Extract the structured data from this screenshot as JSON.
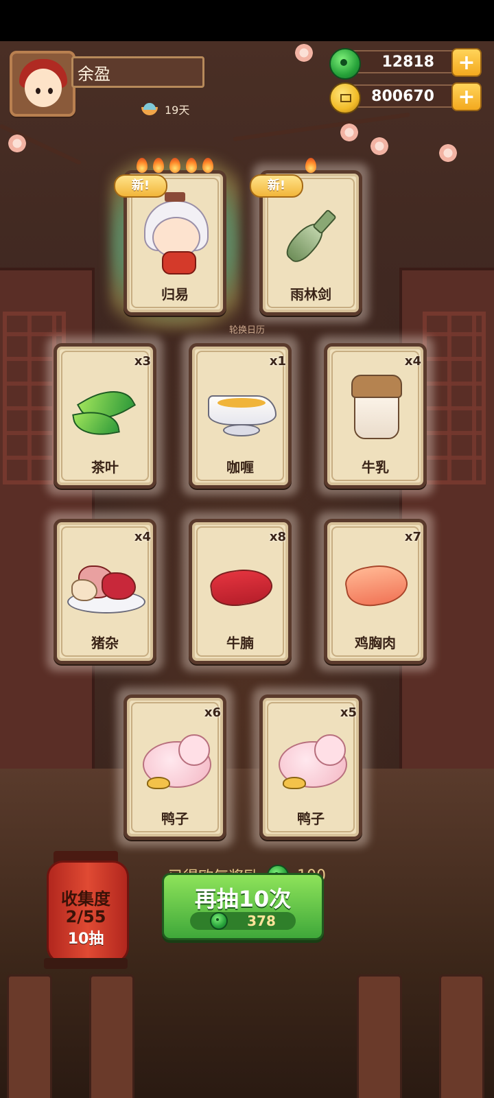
{
  "player": {
    "name": "余盈",
    "days": "19天"
  },
  "currencies": {
    "jade": "12818",
    "coins": "800670",
    "plus_label": "+"
  },
  "background_text": {
    "calendar": "轮换日历"
  },
  "new_label": "新!",
  "featured_cards": [
    {
      "name": "归易",
      "stars": 5,
      "is_new": true,
      "icon": "chef-character-icon"
    },
    {
      "name": "雨林剑",
      "stars": 1,
      "is_new": true,
      "icon": "jade-sword-icon"
    }
  ],
  "cards": [
    {
      "name": "茶叶",
      "count": "x3",
      "icon": "tea-leaf-icon"
    },
    {
      "name": "咖喱",
      "count": "x1",
      "icon": "curry-gravy-boat-icon"
    },
    {
      "name": "牛乳",
      "count": "x4",
      "icon": "milk-jar-icon"
    },
    {
      "name": "猪杂",
      "count": "x4",
      "icon": "pork-offal-plate-icon"
    },
    {
      "name": "牛腩",
      "count": "x8",
      "icon": "beef-brisket-icon"
    },
    {
      "name": "鸡胸肉",
      "count": "x7",
      "icon": "chicken-breast-icon"
    },
    {
      "name": "鸭子",
      "count": "x6",
      "icon": "duck-icon"
    },
    {
      "name": "鸭子",
      "count": "x5",
      "icon": "duck-icon"
    }
  ],
  "reward": {
    "label": "已得欧气奖励",
    "amount": "100"
  },
  "collection": {
    "title": "收集度",
    "progress": "2/55",
    "draws": "10抽"
  },
  "draw_button": {
    "label": "再抽10次",
    "cost": "378"
  },
  "colors": {
    "jade": "#27a33a",
    "gold": "#f1bb28",
    "button_green": "#5cc246",
    "lantern_red": "#d63a2b"
  }
}
